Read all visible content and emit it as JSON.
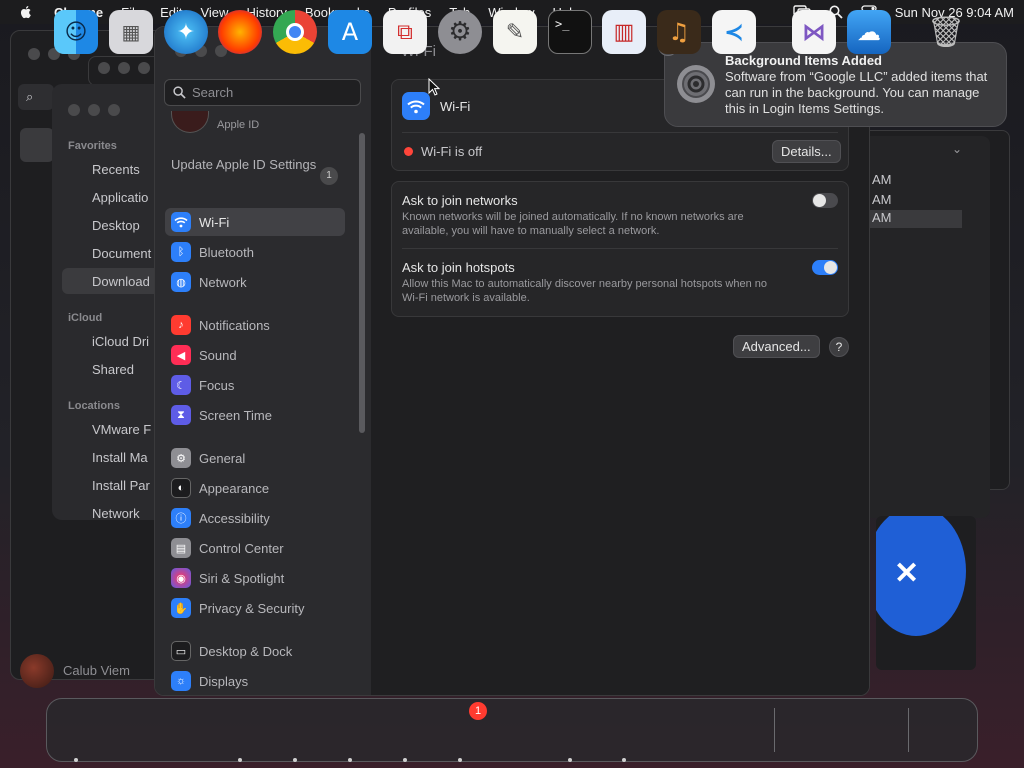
{
  "menubar": {
    "app_name": "Chrome",
    "items": [
      "File",
      "Edit",
      "View",
      "History",
      "Bookmarks",
      "Profiles",
      "Tab",
      "Window",
      "Help"
    ],
    "datetime": "Sun Nov 26  9:04 AM"
  },
  "finder": {
    "sections": {
      "favorites": "Favorites",
      "icloud": "iCloud",
      "locations": "Locations"
    },
    "favorites": [
      "Recents",
      "Applicatio",
      "Desktop",
      "Document",
      "Download"
    ],
    "icloud": [
      "iCloud Dri",
      "Shared"
    ],
    "locations": [
      "VMware F",
      "Install Ma",
      "Install Par",
      "Network"
    ],
    "user_name": "Calub Viem"
  },
  "settings": {
    "search_placeholder": "Search",
    "apple_id_label": "Apple ID",
    "update_label": "Update Apple ID Settings",
    "update_count": "1",
    "sidebar": [
      {
        "label": "Wi-Fi",
        "icon": "wifi-icon",
        "color": "#2d7ff9"
      },
      {
        "label": "Bluetooth",
        "icon": "bluetooth-icon",
        "color": "#2d7ff9"
      },
      {
        "label": "Network",
        "icon": "globe-icon",
        "color": "#2d7ff9"
      },
      {
        "label": "Notifications",
        "icon": "bell-icon",
        "color": "#ff3b30"
      },
      {
        "label": "Sound",
        "icon": "speaker-icon",
        "color": "#ff2d55"
      },
      {
        "label": "Focus",
        "icon": "moon-icon",
        "color": "#5e5ce6"
      },
      {
        "label": "Screen Time",
        "icon": "hourglass-icon",
        "color": "#5e5ce6"
      },
      {
        "label": "General",
        "icon": "gear-icon",
        "color": "#8e8e93"
      },
      {
        "label": "Appearance",
        "icon": "appearance-icon",
        "color": "#1c1c1e"
      },
      {
        "label": "Accessibility",
        "icon": "accessibility-icon",
        "color": "#2d7ff9"
      },
      {
        "label": "Control Center",
        "icon": "control-center-icon",
        "color": "#8e8e93"
      },
      {
        "label": "Siri & Spotlight",
        "icon": "siri-icon",
        "color": "#af52de"
      },
      {
        "label": "Privacy & Security",
        "icon": "hand-icon",
        "color": "#2d7ff9"
      },
      {
        "label": "Desktop & Dock",
        "icon": "dock-icon",
        "color": "#1c1c1e"
      },
      {
        "label": "Displays",
        "icon": "display-icon",
        "color": "#2d7ff9"
      }
    ],
    "content": {
      "title": "Wi-Fi",
      "wifi_label": "Wi-Fi",
      "status": "Wi-Fi is off",
      "details_button": "Details...",
      "ask_networks_title": "Ask to join networks",
      "ask_networks_desc": "Known networks will be joined automatically. If no known networks are available, you will have to manually select a network.",
      "ask_networks_on": false,
      "ask_hotspots_title": "Ask to join hotspots",
      "ask_hotspots_desc": "Allow this Mac to automatically discover nearby personal hotspots when no Wi-Fi network is available.",
      "ask_hotspots_on": true,
      "advanced_button": "Advanced...",
      "help_button": "?"
    }
  },
  "notification": {
    "title": "Background Items Added",
    "body": "Software from “Google LLC” added items that can run in the background. You can manage this in Login Items Settings.",
    "close": "×"
  },
  "bg_list": [
    "AM",
    "AM",
    "AM"
  ],
  "dock": {
    "apps": [
      "Finder",
      "Launchpad",
      "Safari",
      "Firefox",
      "Chrome",
      "App Store",
      "Parallels",
      "System Settings",
      "TextEdit",
      "Terminal",
      "Parallels Desktop",
      "GarageBand",
      "Visual Studio Code",
      "Visual Studio",
      "Weather",
      "Trash"
    ],
    "settings_badge": "1"
  }
}
